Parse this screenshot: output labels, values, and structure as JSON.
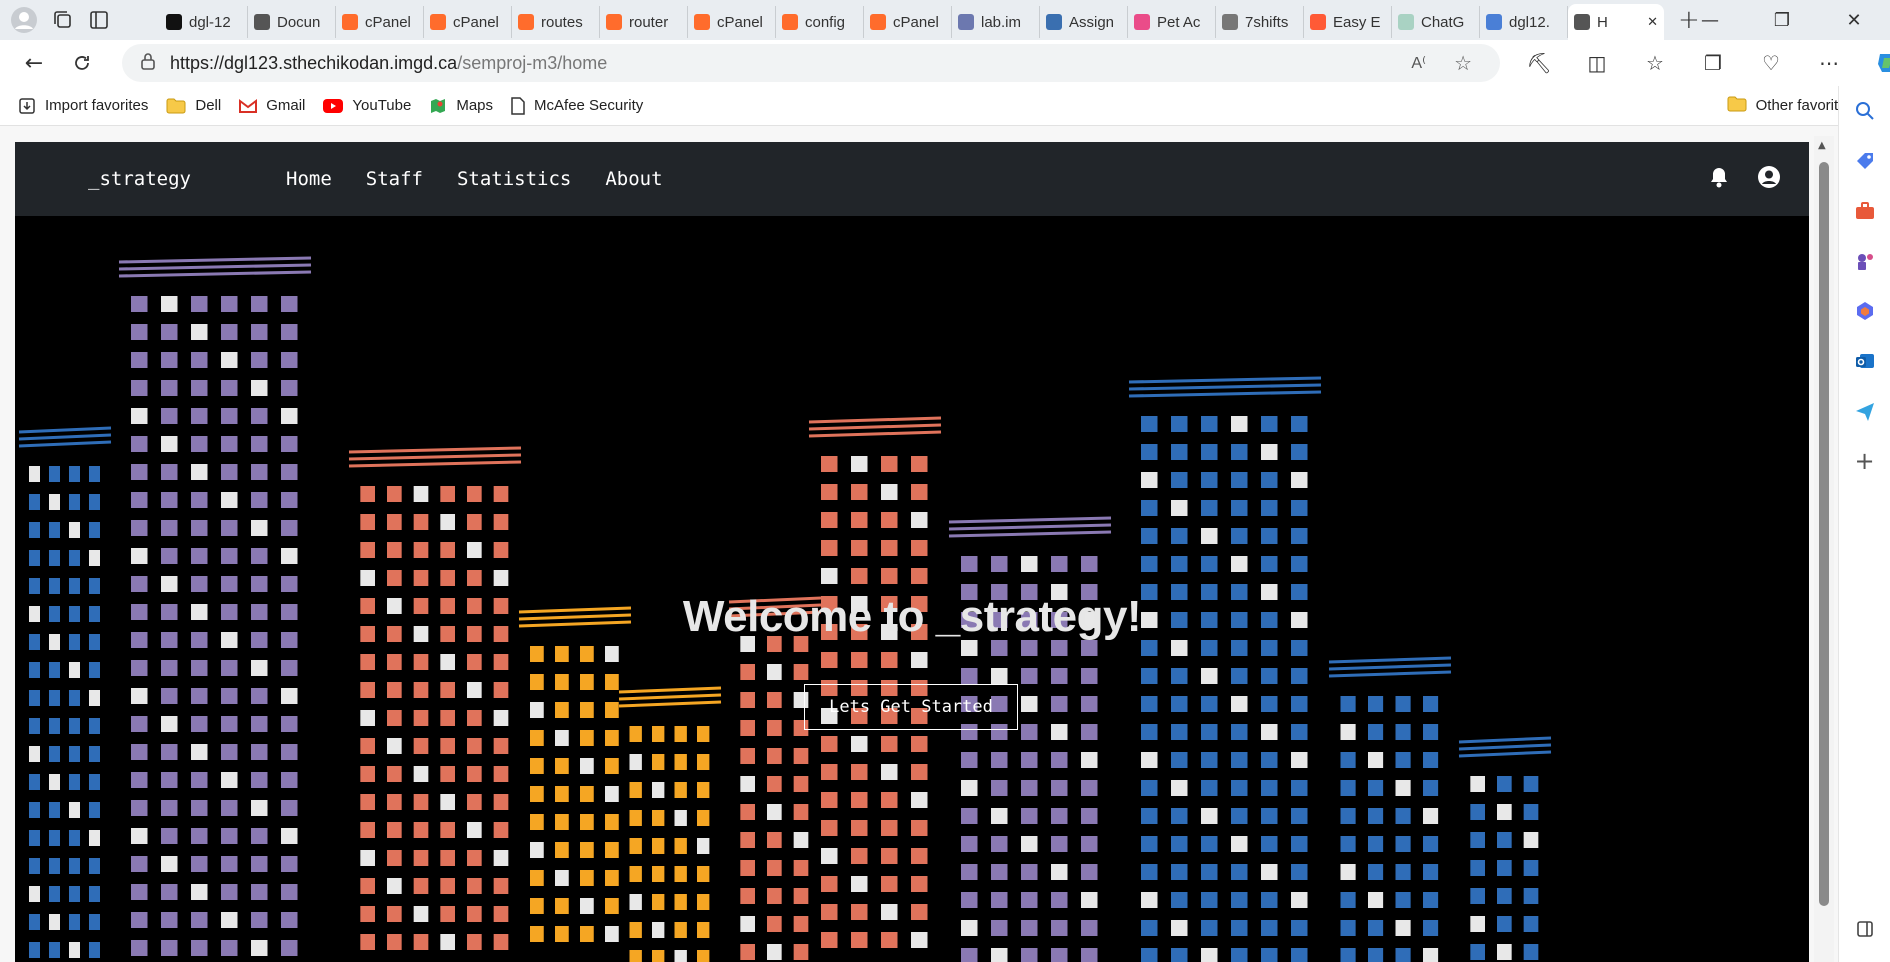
{
  "browser": {
    "tabs": [
      {
        "label": "dgl-12",
        "icon": "github-icon",
        "color": "#111111"
      },
      {
        "label": "Docun",
        "icon": "document-icon",
        "color": "#555555"
      },
      {
        "label": "cPanel",
        "icon": "cpanel-icon",
        "color": "#ff6c2c"
      },
      {
        "label": "cPanel",
        "icon": "cpanel-icon",
        "color": "#ff6c2c"
      },
      {
        "label": "routes",
        "icon": "cpanel-icon",
        "color": "#ff6c2c"
      },
      {
        "label": "router",
        "icon": "cpanel-icon",
        "color": "#ff6c2c"
      },
      {
        "label": "cPanel",
        "icon": "cpanel-icon",
        "color": "#ff6c2c"
      },
      {
        "label": "config",
        "icon": "cpanel-icon",
        "color": "#ff6c2c"
      },
      {
        "label": "cPanel",
        "icon": "cpanel-icon",
        "color": "#ff6c2c"
      },
      {
        "label": "lab.im",
        "icon": "phpmyadmin-icon",
        "color": "#6c78af"
      },
      {
        "label": "Assign",
        "icon": "chart-icon",
        "color": "#3a6fb0"
      },
      {
        "label": "Pet Ac",
        "icon": "dribbble-icon",
        "color": "#ea4c89"
      },
      {
        "label": "7shifts",
        "icon": "sevenshifts-icon",
        "color": "#777777"
      },
      {
        "label": "Easy E",
        "icon": "easy-icon",
        "color": "#ff5a36"
      },
      {
        "label": "ChatG",
        "icon": "chatgpt-icon",
        "color": "#a9d2c3"
      },
      {
        "label": "dgl12.",
        "icon": "search-icon",
        "color": "#4a7fd6"
      },
      {
        "label": "H",
        "icon": "document-icon",
        "color": "#555555",
        "active": true
      }
    ],
    "url_host": "https://dgl123.sthechikodan.imgd.ca",
    "url_path": "/semproj-m3/home",
    "favorites": [
      {
        "label": "Import favorites",
        "icon": "import-icon"
      },
      {
        "label": "Dell",
        "icon": "folder-icon"
      },
      {
        "label": "Gmail",
        "icon": "gmail-icon"
      },
      {
        "label": "YouTube",
        "icon": "youtube-icon"
      },
      {
        "label": "Maps",
        "icon": "maps-icon"
      },
      {
        "label": "McAfee Security",
        "icon": "document-icon"
      }
    ],
    "other_favorites": "Other favorites"
  },
  "site": {
    "brand": "_strategy",
    "nav": [
      "Home",
      "Staff",
      "Statistics",
      "About"
    ],
    "hero_title": "Welcome to _strategy!",
    "cta_label": "Lets Get Started"
  },
  "colors": {
    "navbar": "#212529",
    "hero_bg": "#000000",
    "building_blue": "#2f6db8",
    "building_orange": "#f5a623",
    "building_red": "#e0735b",
    "building_purple": "#8a79b3"
  }
}
